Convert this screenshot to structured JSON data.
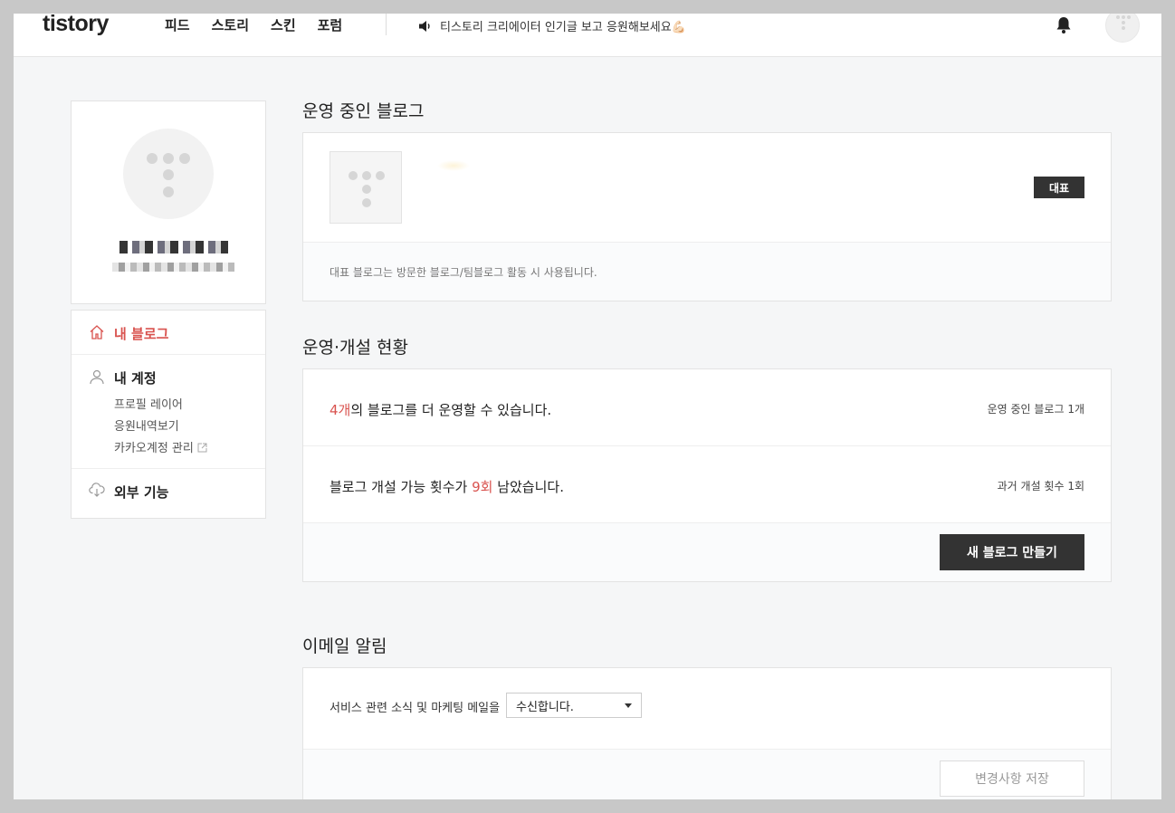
{
  "header": {
    "logo": "tistory",
    "nav": [
      "피드",
      "스토리",
      "스킨",
      "포럼"
    ],
    "announcement": "티스토리 크리에이터 인기글 보고 응원해보세요💪🏻"
  },
  "sidebar": {
    "my_blog": "내 블로그",
    "my_account": "내 계정",
    "account_items": [
      "프로필 레이어",
      "응원내역보기",
      "카카오계정 관리"
    ],
    "external": "외부 기능"
  },
  "operating": {
    "title": "운영 중인 블로그",
    "badge": "대표",
    "note": "대표 블로그는 방문한 블로그/팀블로그 활동 시 사용됩니다."
  },
  "status": {
    "title": "운영·개설 현황",
    "row1_count": "4개",
    "row1_rest": "의 블로그를 더 운영할 수 있습니다.",
    "row1_right": "운영 중인 블로그 1개",
    "row2_pre": "블로그 개설 가능 횟수가 ",
    "row2_count": "9회",
    "row2_post": " 남았습니다.",
    "row2_right": "과거 개설 횟수 1회",
    "new_blog_button": "새 블로그 만들기"
  },
  "email": {
    "title": "이메일 알림",
    "label": "서비스 관련 소식 및 마케팅 메일을",
    "select_value": "수신합니다.",
    "save_button": "변경사항 저장"
  },
  "colors": {
    "accent": "#d9534f",
    "dark": "#333333"
  }
}
